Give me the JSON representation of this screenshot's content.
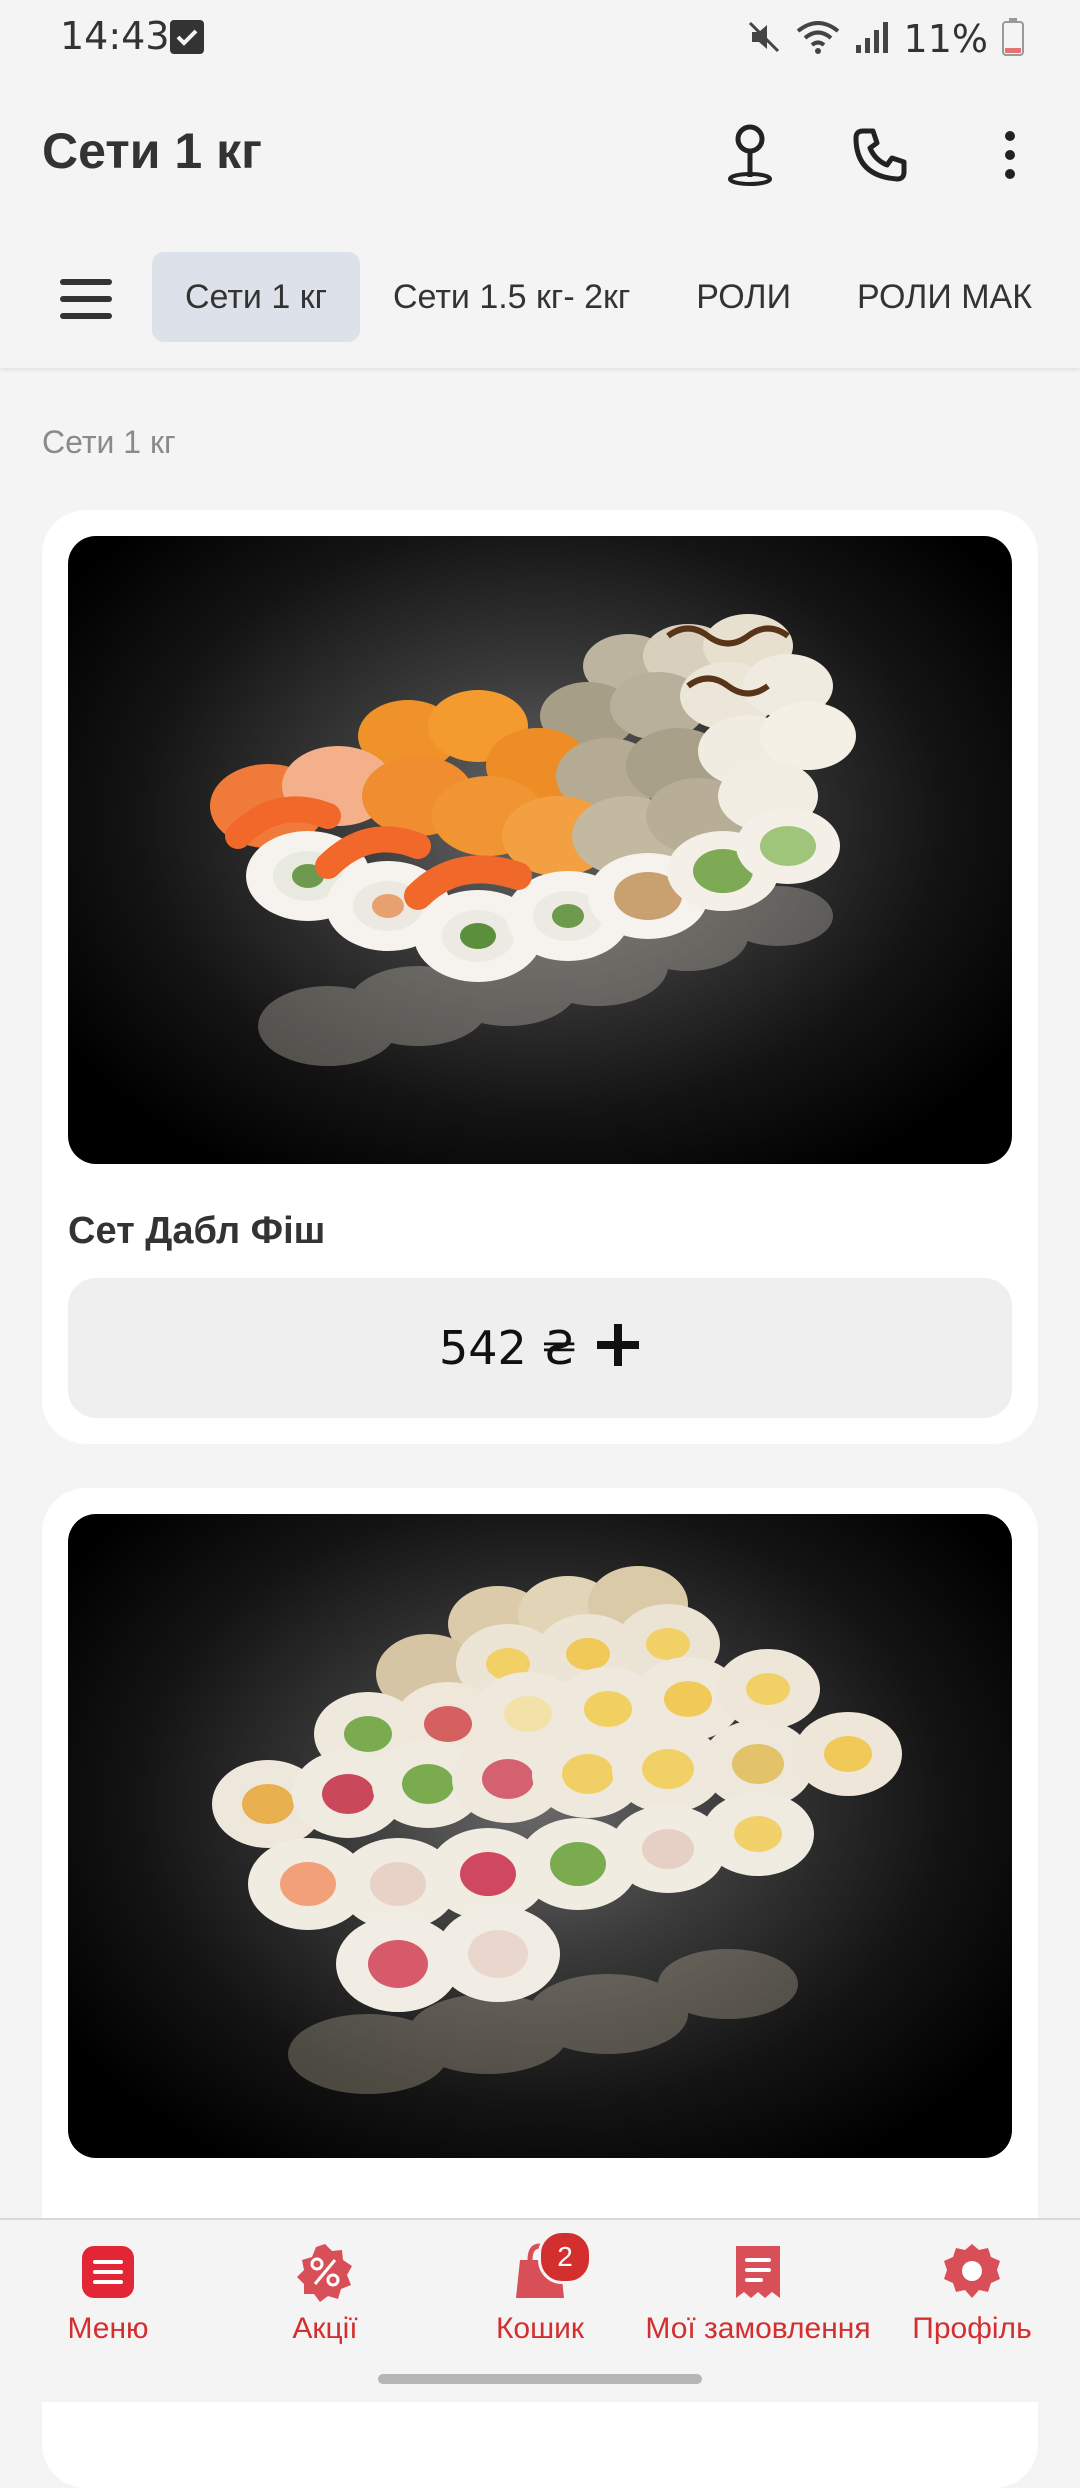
{
  "status_bar": {
    "time": "14:43",
    "battery": "11%",
    "icons": [
      "checkbox-notification-icon",
      "mute-icon",
      "wifi-icon",
      "signal-icon",
      "battery-icon"
    ]
  },
  "app_bar": {
    "title": "Сети 1 кг",
    "actions": [
      "location-pin-icon",
      "phone-icon",
      "more-vert-icon"
    ]
  },
  "tabs": [
    {
      "label": "Сети 1 кг",
      "active": true
    },
    {
      "label": "Сети 1.5 кг- 2кг",
      "active": false
    },
    {
      "label": "РОЛИ",
      "active": false
    },
    {
      "label": "РОЛИ МАК",
      "active": false
    }
  ],
  "section": {
    "label": "Сети 1 кг"
  },
  "products": [
    {
      "title": "Сет Дабл Фіш",
      "price": "542 ₴",
      "image": "sushi-set-photo"
    },
    {
      "title": "",
      "price": "",
      "image": "sushi-set-photo"
    }
  ],
  "bottom_nav": {
    "items": [
      {
        "label": "Меню",
        "icon": "menu-list-icon"
      },
      {
        "label": "Акції",
        "icon": "discount-icon"
      },
      {
        "label": "Кошик",
        "icon": "cart-icon",
        "badge": "2"
      },
      {
        "label": "Мої замовлення",
        "icon": "receipt-icon"
      },
      {
        "label": "Профіль",
        "icon": "profile-icon"
      }
    ]
  },
  "colors": {
    "accent": "#d32f2f",
    "background": "#f4f4f5",
    "active_tab": "#dde2ea"
  }
}
